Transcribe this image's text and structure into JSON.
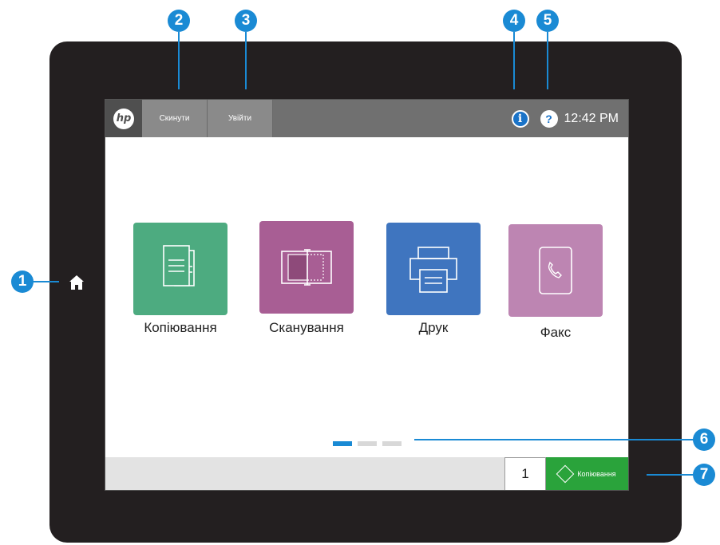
{
  "topbar": {
    "logo_text": "hp",
    "reset_label": "Скинути",
    "signin_label": "Увійти",
    "time": "12:42 PM"
  },
  "tiles": [
    {
      "label": "Копіювання",
      "color": "#4dab80",
      "icon": "copy-icon"
    },
    {
      "label": "Сканування",
      "color": "#a85e94",
      "icon": "scan-icon"
    },
    {
      "label": "Друк",
      "color": "#3f75bf",
      "icon": "print-icon"
    },
    {
      "label": "Факс",
      "color": "#bd85b2",
      "icon": "fax-icon"
    }
  ],
  "pager": {
    "pages": 3,
    "active": 1
  },
  "bottombar": {
    "copies": "1",
    "start_label": "Копіювання"
  },
  "callouts": [
    "1",
    "2",
    "3",
    "4",
    "5",
    "6",
    "7"
  ],
  "colors": {
    "callout": "#1a8ad4",
    "start": "#2aa33b",
    "topbar": "#707070"
  }
}
